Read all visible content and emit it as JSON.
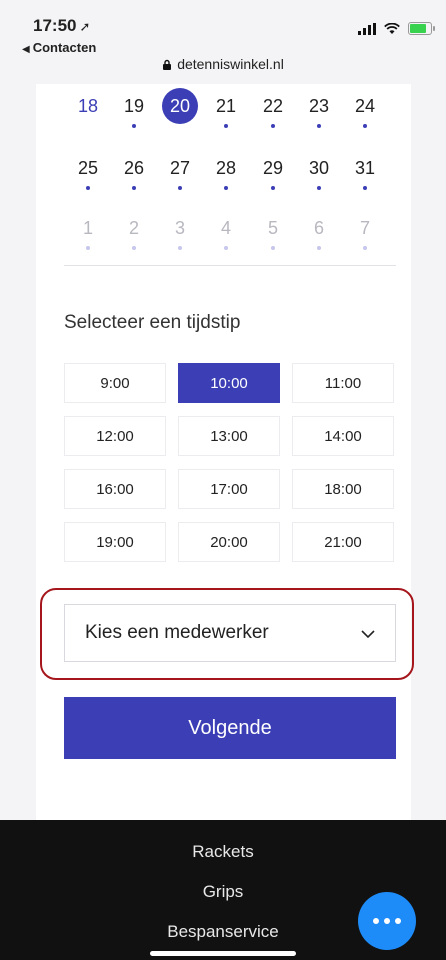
{
  "status_bar": {
    "time": "17:50",
    "back_label": "Contacten",
    "url": "detenniswinkel.nl"
  },
  "calendar": {
    "rows": [
      [
        {
          "day": "18",
          "state": "prev"
        },
        {
          "day": "19",
          "state": "available"
        },
        {
          "day": "20",
          "state": "selected"
        },
        {
          "day": "21",
          "state": "available"
        },
        {
          "day": "22",
          "state": "available"
        },
        {
          "day": "23",
          "state": "available"
        },
        {
          "day": "24",
          "state": "available"
        }
      ],
      [
        {
          "day": "25",
          "state": "available"
        },
        {
          "day": "26",
          "state": "available"
        },
        {
          "day": "27",
          "state": "available"
        },
        {
          "day": "28",
          "state": "available"
        },
        {
          "day": "29",
          "state": "available"
        },
        {
          "day": "30",
          "state": "available"
        },
        {
          "day": "31",
          "state": "available"
        }
      ],
      [
        {
          "day": "1",
          "state": "faded"
        },
        {
          "day": "2",
          "state": "faded"
        },
        {
          "day": "3",
          "state": "faded"
        },
        {
          "day": "4",
          "state": "faded"
        },
        {
          "day": "5",
          "state": "faded"
        },
        {
          "day": "6",
          "state": "faded"
        },
        {
          "day": "7",
          "state": "faded"
        }
      ]
    ]
  },
  "time_section": {
    "title": "Selecteer een tijdstip",
    "slots": [
      "9:00",
      "10:00",
      "11:00",
      "12:00",
      "13:00",
      "14:00",
      "16:00",
      "17:00",
      "18:00",
      "19:00",
      "20:00",
      "21:00"
    ],
    "selected": "10:00"
  },
  "employee_select": {
    "label": "Kies een medewerker"
  },
  "next_button": {
    "label": "Volgende"
  },
  "footer": {
    "links": [
      "Rackets",
      "Grips",
      "Bespanservice"
    ]
  },
  "colors": {
    "accent": "#3b3eb5",
    "highlight": "#a5161c",
    "footer_bg": "#111111",
    "chat_button": "#1e8cf8"
  }
}
